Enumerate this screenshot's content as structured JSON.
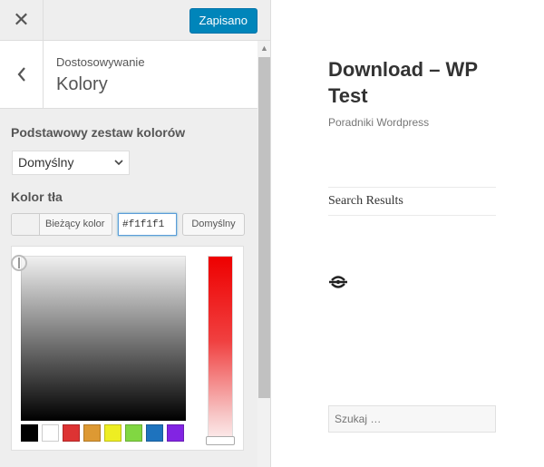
{
  "header": {
    "close_glyph": "✕",
    "save_label": "Zapisano"
  },
  "section": {
    "breadcrumb": "Dostosowywanie",
    "title": "Kolory"
  },
  "controls": {
    "color_scheme": {
      "title": "Podstawowy zestaw kolorów",
      "selected": "Domyślny",
      "chevron": "⌄"
    },
    "background_color": {
      "title": "Kolor tła",
      "current_label": "Bieżący kolor",
      "current_color": "#f1f1f1",
      "hex_value": "#f1f1f1",
      "default_label": "Domyślny"
    },
    "palette": [
      "#000000",
      "#ffffff",
      "#dd3333",
      "#dd9933",
      "#eeee22",
      "#81d742",
      "#1e73be",
      "#8224e3"
    ]
  },
  "preview": {
    "site_title": "Download – WP Test",
    "tagline": "Poradniki Wordpress",
    "search_results": "Search Results",
    "search_placeholder": "Szukaj …"
  }
}
